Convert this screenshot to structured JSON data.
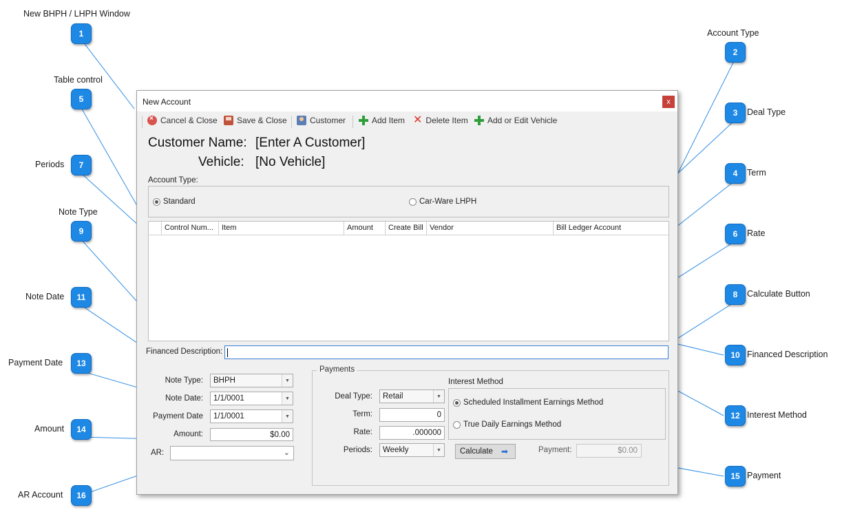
{
  "callouts": [
    {
      "num": "1",
      "label": "New BHPH / LHPH Window"
    },
    {
      "num": "2",
      "label": "Account Type"
    },
    {
      "num": "3",
      "label": "Deal Type"
    },
    {
      "num": "4",
      "label": "Term"
    },
    {
      "num": "5",
      "label": "Table control"
    },
    {
      "num": "6",
      "label": "Rate"
    },
    {
      "num": "7",
      "label": "Periods"
    },
    {
      "num": "8",
      "label": "Calculate Button"
    },
    {
      "num": "9",
      "label": "Note Type"
    },
    {
      "num": "10",
      "label": "Financed Description"
    },
    {
      "num": "11",
      "label": "Note Date"
    },
    {
      "num": "12",
      "label": "Interest Method"
    },
    {
      "num": "13",
      "label": "Payment Date"
    },
    {
      "num": "14",
      "label": "Amount"
    },
    {
      "num": "15",
      "label": "Payment"
    },
    {
      "num": "16",
      "label": "AR Account"
    }
  ],
  "window": {
    "title": "New Account",
    "close_label": "x"
  },
  "toolbar": {
    "cancel_close": "Cancel & Close",
    "save_close": "Save & Close",
    "customer": "Customer",
    "add_item": "Add Item",
    "delete_item": "Delete Item",
    "add_edit_vehicle": "Add or Edit Vehicle"
  },
  "header": {
    "customer_label": "Customer Name:",
    "customer_value": "[Enter A Customer]",
    "vehicle_label": "Vehicle:",
    "vehicle_value": "[No Vehicle]"
  },
  "account_type": {
    "label": "Account Type:",
    "options": [
      "Standard",
      "Car-Ware LHPH"
    ],
    "selected": "Standard"
  },
  "table": {
    "columns": [
      "Control Num...",
      "Item",
      "Amount",
      "Create Bill",
      "Vendor",
      "Bill Ledger Account"
    ],
    "rows": []
  },
  "financed_description": {
    "label": "Financed Description:",
    "value": ""
  },
  "note": {
    "note_type_label": "Note Type:",
    "note_type_value": "BHPH",
    "note_date_label": "Note Date:",
    "note_date_value": "1/1/0001",
    "payment_date_label": "Payment Date",
    "payment_date_value": "1/1/0001",
    "amount_label": "Amount:",
    "amount_value": "$0.00",
    "ar_label": "AR:",
    "ar_value": ""
  },
  "payments": {
    "group_title": "Payments",
    "deal_type_label": "Deal Type:",
    "deal_type_value": "Retail",
    "term_label": "Term:",
    "term_value": "0",
    "rate_label": "Rate:",
    "rate_value": ".000000",
    "periods_label": "Periods:",
    "periods_value": "Weekly",
    "interest_method_label": "Interest Method",
    "interest_options": [
      "Scheduled Installment Earnings Method",
      "True Daily Earnings Method"
    ],
    "interest_selected": "Scheduled Installment Earnings Method",
    "calculate_label": "Calculate",
    "payment_label": "Payment:",
    "payment_value": "$0.00"
  },
  "colors": {
    "badge": "#1e88e5",
    "close_button": "#c8403a",
    "window_bg": "#f0f0f0"
  }
}
